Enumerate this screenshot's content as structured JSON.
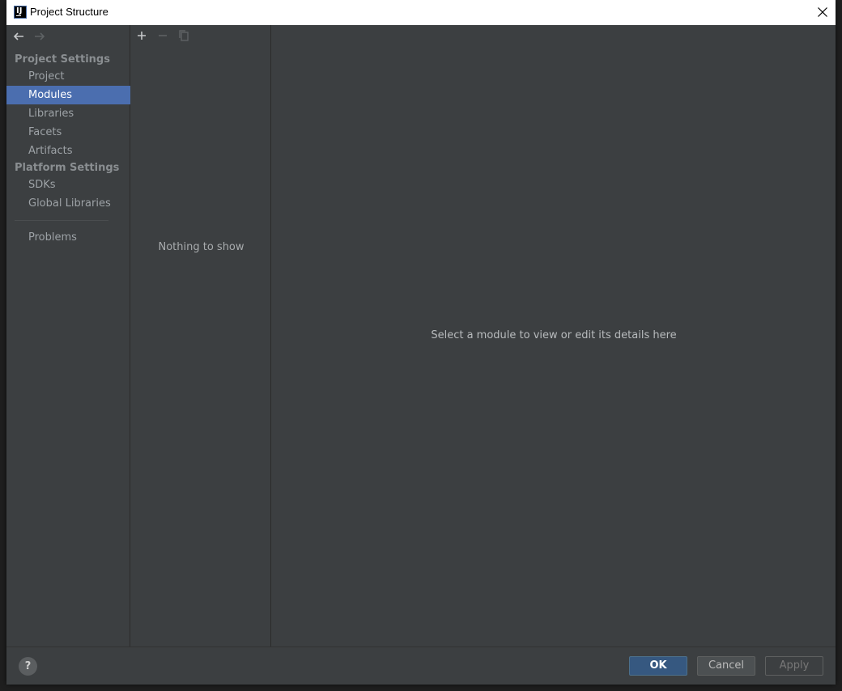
{
  "window": {
    "title": "Project Structure",
    "app_icon": "intellij-logo-icon"
  },
  "sidebar": {
    "project_settings_header": "Project Settings",
    "platform_settings_header": "Platform Settings",
    "items": [
      {
        "label": "Project",
        "selected": false
      },
      {
        "label": "Modules",
        "selected": true
      },
      {
        "label": "Libraries",
        "selected": false
      },
      {
        "label": "Facets",
        "selected": false
      },
      {
        "label": "Artifacts",
        "selected": false
      },
      {
        "label": "SDKs",
        "selected": false
      },
      {
        "label": "Global Libraries",
        "selected": false
      },
      {
        "label": "Problems",
        "selected": false
      }
    ]
  },
  "listpane": {
    "empty_text": "Nothing to show",
    "toolbar": [
      "add-icon",
      "remove-icon",
      "copy-icon"
    ]
  },
  "details": {
    "placeholder": "Select a module to view or edit its details here"
  },
  "footer": {
    "help_label": "?",
    "ok_label": "OK",
    "cancel_label": "Cancel",
    "apply_label": "Apply"
  },
  "colors": {
    "background": "#3c3f41",
    "selection": "#4b6eaf",
    "ok_button": "#365880"
  }
}
